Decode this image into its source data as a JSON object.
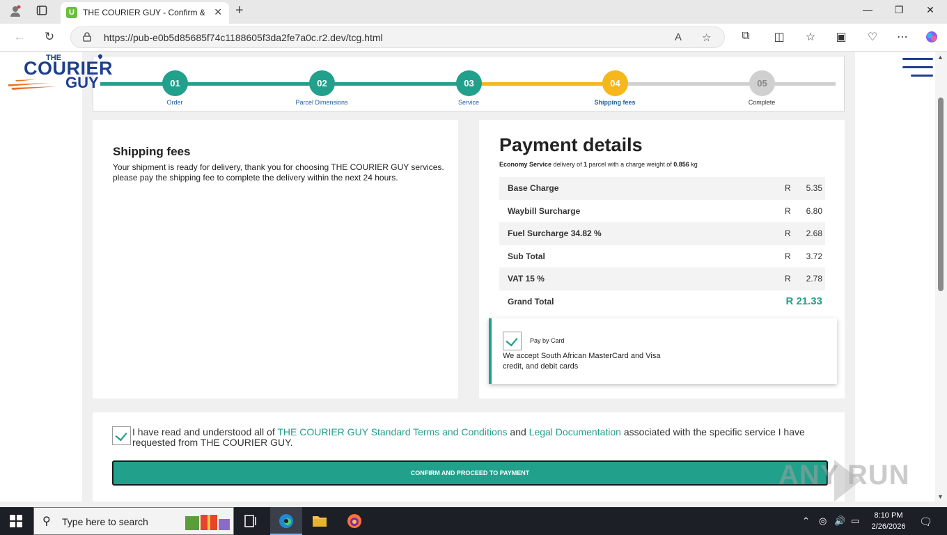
{
  "browser": {
    "tab_title": "THE COURIER GUY - Confirm & Pa",
    "url": "https://pub-e0b5d85685f74c1188605f3da2fe7a0c.r2.dev/tcg.html"
  },
  "logo": {
    "line1": "THE",
    "line2": "COURIER",
    "line3": "GUY"
  },
  "steps": [
    {
      "num": "01",
      "label": "Order",
      "state": "done"
    },
    {
      "num": "02",
      "label": "Parcel Dimensions",
      "state": "done"
    },
    {
      "num": "03",
      "label": "Service",
      "state": "done"
    },
    {
      "num": "04",
      "label": "Shipping fees",
      "state": "active"
    },
    {
      "num": "05",
      "label": "Complete",
      "state": "pending"
    }
  ],
  "shipping": {
    "title": "Shipping fees",
    "text": "Your shipment is ready for delivery, thank you for choosing THE COURIER GUY services. please pay the shipping fee to complete the delivery within the next 24 hours."
  },
  "payment": {
    "title": "Payment details",
    "service": "Economy Service",
    "sub_mid": "delivery of",
    "parcels": "1",
    "sub_mid2": "parcel with a charge weight of",
    "weight": "0.856",
    "unit": "kg",
    "currency": "R",
    "rows": [
      {
        "label": "Base Charge",
        "value": "5.35"
      },
      {
        "label": "Waybill Surcharge",
        "value": "6.80"
      },
      {
        "label": "Fuel Surcharge 34.82 %",
        "value": "2.68"
      },
      {
        "label": "Sub Total",
        "value": "3.72"
      },
      {
        "label": "VAT 15 %",
        "value": "2.78"
      }
    ],
    "grand_label": "Grand Total",
    "grand_value": "R 21.33",
    "card_option": "Pay by Card",
    "card_text": "We accept South African MasterCard and Visa credit, and debit cards"
  },
  "terms": {
    "t1": "I have read and understood all of ",
    "link1": "THE COURIER GUY Standard Terms and Conditions",
    "t2": " and ",
    "link2": "Legal Documentation",
    "t3": " associated with the specific service I have requested from THE COURIER GUY.",
    "button": "CONFIRM AND PROCEED TO PAYMENT"
  },
  "taskbar": {
    "search_placeholder": "Type here to search",
    "time": "8:10 PM",
    "date": "2/26/2026"
  },
  "watermark": "ANY RUN",
  "colors": {
    "teal": "#21a08c",
    "yellow": "#f5b71c",
    "navy": "#1e3f8f",
    "grey": "#cccccc"
  }
}
